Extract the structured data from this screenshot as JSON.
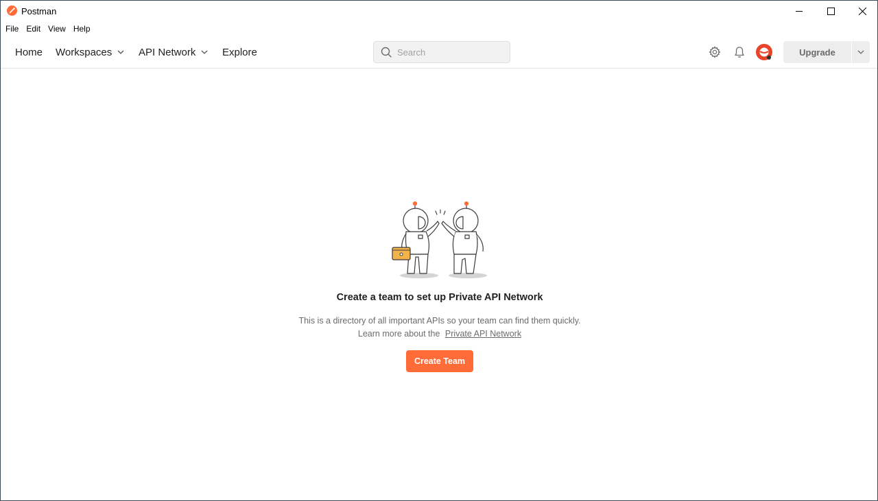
{
  "window": {
    "title": "Postman",
    "icons": {
      "logo": "postman-logo-icon",
      "minimize": "minimize-icon",
      "maximize": "maximize-icon",
      "close": "close-icon"
    }
  },
  "menubar": {
    "items": [
      "File",
      "Edit",
      "View",
      "Help"
    ]
  },
  "nav": {
    "home": "Home",
    "workspaces": "Workspaces",
    "api_network": "API Network",
    "explore": "Explore"
  },
  "search": {
    "placeholder": "Search",
    "value": ""
  },
  "header": {
    "upgrade_label": "Upgrade",
    "icons": [
      "settings-icon",
      "bell-icon",
      "avatar",
      "chevron-down-icon"
    ]
  },
  "empty_state": {
    "title": "Create a team to set up Private API Network",
    "description_line1": "This is a directory of all important APIs so your team can find them quickly.",
    "description_line2": "Learn more about the",
    "link_text": "Private API Network",
    "button_label": "Create Team"
  },
  "colors": {
    "accent": "#ff6c37",
    "folder": "#f4b24a",
    "text": "#212121",
    "muted": "#6b6b6b"
  }
}
